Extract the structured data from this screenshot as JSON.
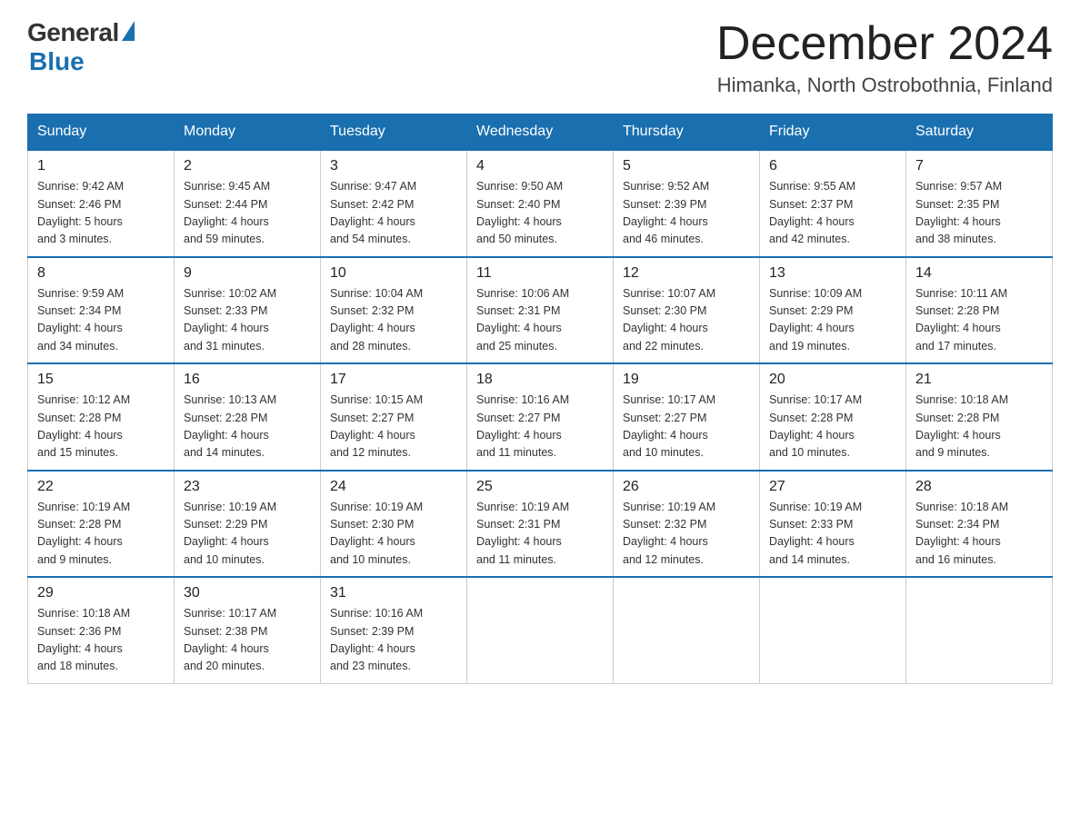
{
  "logo": {
    "general": "General",
    "blue": "Blue"
  },
  "title": {
    "month": "December 2024",
    "location": "Himanka, North Ostrobothnia, Finland"
  },
  "weekdays": [
    "Sunday",
    "Monday",
    "Tuesday",
    "Wednesday",
    "Thursday",
    "Friday",
    "Saturday"
  ],
  "weeks": [
    [
      {
        "day": "1",
        "sunrise": "9:42 AM",
        "sunset": "2:46 PM",
        "daylight": "5 hours and 3 minutes."
      },
      {
        "day": "2",
        "sunrise": "9:45 AM",
        "sunset": "2:44 PM",
        "daylight": "4 hours and 59 minutes."
      },
      {
        "day": "3",
        "sunrise": "9:47 AM",
        "sunset": "2:42 PM",
        "daylight": "4 hours and 54 minutes."
      },
      {
        "day": "4",
        "sunrise": "9:50 AM",
        "sunset": "2:40 PM",
        "daylight": "4 hours and 50 minutes."
      },
      {
        "day": "5",
        "sunrise": "9:52 AM",
        "sunset": "2:39 PM",
        "daylight": "4 hours and 46 minutes."
      },
      {
        "day": "6",
        "sunrise": "9:55 AM",
        "sunset": "2:37 PM",
        "daylight": "4 hours and 42 minutes."
      },
      {
        "day": "7",
        "sunrise": "9:57 AM",
        "sunset": "2:35 PM",
        "daylight": "4 hours and 38 minutes."
      }
    ],
    [
      {
        "day": "8",
        "sunrise": "9:59 AM",
        "sunset": "2:34 PM",
        "daylight": "4 hours and 34 minutes."
      },
      {
        "day": "9",
        "sunrise": "10:02 AM",
        "sunset": "2:33 PM",
        "daylight": "4 hours and 31 minutes."
      },
      {
        "day": "10",
        "sunrise": "10:04 AM",
        "sunset": "2:32 PM",
        "daylight": "4 hours and 28 minutes."
      },
      {
        "day": "11",
        "sunrise": "10:06 AM",
        "sunset": "2:31 PM",
        "daylight": "4 hours and 25 minutes."
      },
      {
        "day": "12",
        "sunrise": "10:07 AM",
        "sunset": "2:30 PM",
        "daylight": "4 hours and 22 minutes."
      },
      {
        "day": "13",
        "sunrise": "10:09 AM",
        "sunset": "2:29 PM",
        "daylight": "4 hours and 19 minutes."
      },
      {
        "day": "14",
        "sunrise": "10:11 AM",
        "sunset": "2:28 PM",
        "daylight": "4 hours and 17 minutes."
      }
    ],
    [
      {
        "day": "15",
        "sunrise": "10:12 AM",
        "sunset": "2:28 PM",
        "daylight": "4 hours and 15 minutes."
      },
      {
        "day": "16",
        "sunrise": "10:13 AM",
        "sunset": "2:28 PM",
        "daylight": "4 hours and 14 minutes."
      },
      {
        "day": "17",
        "sunrise": "10:15 AM",
        "sunset": "2:27 PM",
        "daylight": "4 hours and 12 minutes."
      },
      {
        "day": "18",
        "sunrise": "10:16 AM",
        "sunset": "2:27 PM",
        "daylight": "4 hours and 11 minutes."
      },
      {
        "day": "19",
        "sunrise": "10:17 AM",
        "sunset": "2:27 PM",
        "daylight": "4 hours and 10 minutes."
      },
      {
        "day": "20",
        "sunrise": "10:17 AM",
        "sunset": "2:28 PM",
        "daylight": "4 hours and 10 minutes."
      },
      {
        "day": "21",
        "sunrise": "10:18 AM",
        "sunset": "2:28 PM",
        "daylight": "4 hours and 9 minutes."
      }
    ],
    [
      {
        "day": "22",
        "sunrise": "10:19 AM",
        "sunset": "2:28 PM",
        "daylight": "4 hours and 9 minutes."
      },
      {
        "day": "23",
        "sunrise": "10:19 AM",
        "sunset": "2:29 PM",
        "daylight": "4 hours and 10 minutes."
      },
      {
        "day": "24",
        "sunrise": "10:19 AM",
        "sunset": "2:30 PM",
        "daylight": "4 hours and 10 minutes."
      },
      {
        "day": "25",
        "sunrise": "10:19 AM",
        "sunset": "2:31 PM",
        "daylight": "4 hours and 11 minutes."
      },
      {
        "day": "26",
        "sunrise": "10:19 AM",
        "sunset": "2:32 PM",
        "daylight": "4 hours and 12 minutes."
      },
      {
        "day": "27",
        "sunrise": "10:19 AM",
        "sunset": "2:33 PM",
        "daylight": "4 hours and 14 minutes."
      },
      {
        "day": "28",
        "sunrise": "10:18 AM",
        "sunset": "2:34 PM",
        "daylight": "4 hours and 16 minutes."
      }
    ],
    [
      {
        "day": "29",
        "sunrise": "10:18 AM",
        "sunset": "2:36 PM",
        "daylight": "4 hours and 18 minutes."
      },
      {
        "day": "30",
        "sunrise": "10:17 AM",
        "sunset": "2:38 PM",
        "daylight": "4 hours and 20 minutes."
      },
      {
        "day": "31",
        "sunrise": "10:16 AM",
        "sunset": "2:39 PM",
        "daylight": "4 hours and 23 minutes."
      },
      null,
      null,
      null,
      null
    ]
  ]
}
